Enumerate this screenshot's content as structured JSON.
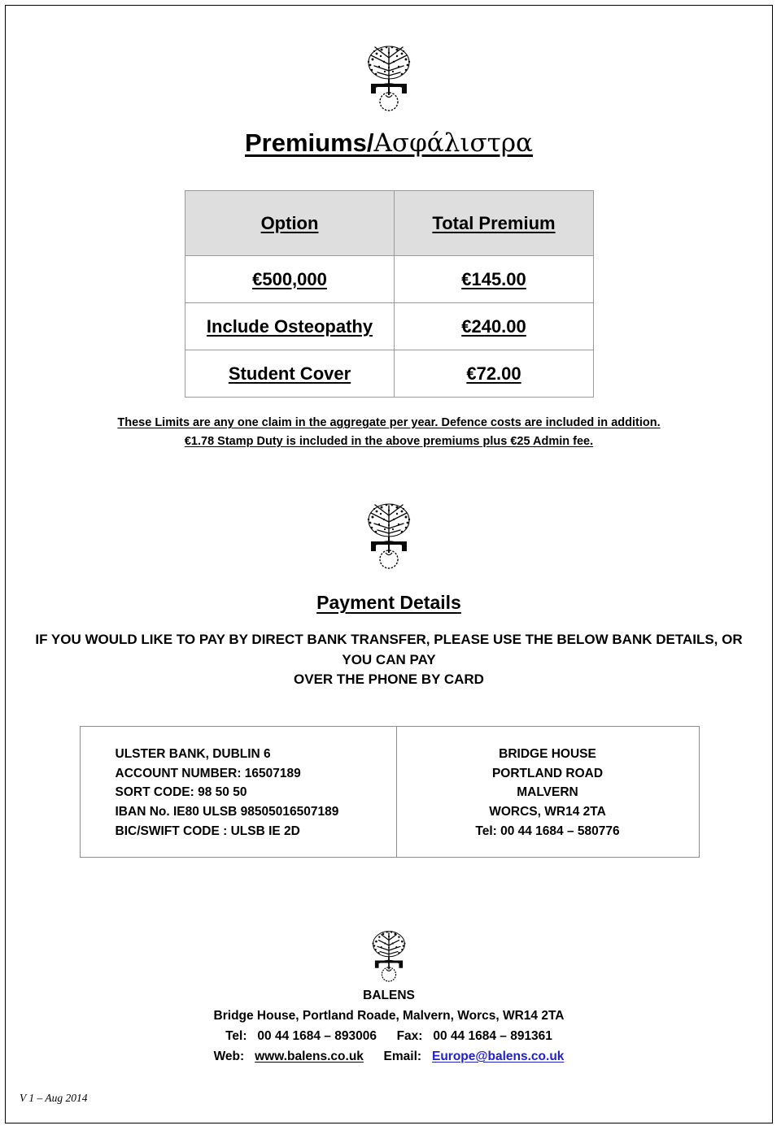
{
  "document": {
    "title_latin": "Premiums/",
    "title_greek": "Ασφάλιστρα",
    "logo_name": "balens-tree-logo",
    "version": "V 1 – Aug 2014",
    "accent_link_color": "#2222cc",
    "header_fill_color": "#dedede",
    "border_color": "#9a9a9a"
  },
  "premium_table": {
    "columns": [
      "Option",
      "Total Premium"
    ],
    "rows": [
      {
        "option": "€500,000",
        "premium": "€145.00"
      },
      {
        "option": "Include Osteopathy",
        "premium": "€240.00"
      },
      {
        "option": "Student Cover",
        "premium": "€72.00"
      }
    ]
  },
  "note": {
    "line1": "These Limits are any one claim in the aggregate per year. Defence costs are included in addition.",
    "line2": "€1.78 Stamp Duty  is included in the above premiums plus €25 Admin fee."
  },
  "payment": {
    "heading": "Payment Details",
    "intro_line1": "IF YOU WOULD LIKE TO PAY BY DIRECT BANK TRANSFER, PLEASE USE THE BELOW BANK DETAILS, OR YOU CAN PAY",
    "intro_line2": "OVER THE PHONE BY CARD",
    "bank": {
      "line1": "ULSTER BANK, DUBLIN 6",
      "line2": "ACCOUNT NUMBER: 16507189",
      "line3": "SORT CODE: 98 50 50",
      "line4": "IBAN No. IE80 ULSB 98505016507189",
      "line5": "BIC/SWIFT CODE : ULSB IE 2D"
    },
    "address": {
      "line1": "BRIDGE HOUSE",
      "line2": "PORTLAND ROAD",
      "line3": "MALVERN",
      "line4": "WORCS, WR14 2TA",
      "line5": "Tel:   00 44 1684 – 580776"
    }
  },
  "footer": {
    "company": "BALENS",
    "address": "Bridge House, Portland Roade, Malvern, Worcs, WR14 2TA",
    "tel_label": "Tel:",
    "tel_value": "00 44 1684 – 893006",
    "fax_label": "Fax:",
    "fax_value": "00 44 1684 – 891361",
    "web_label": "Web:",
    "web_value": "www.balens.co.uk",
    "email_label": "Email:",
    "email_value": "Europe@balens.co.uk"
  }
}
